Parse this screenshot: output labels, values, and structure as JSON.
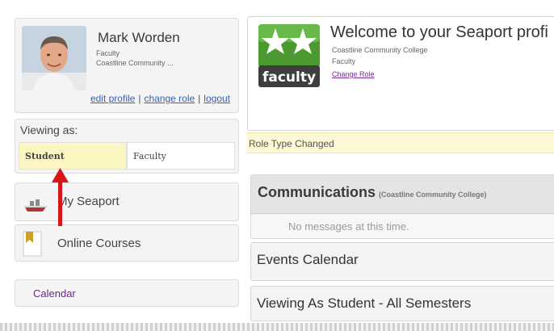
{
  "profile": {
    "name": "Mark Worden",
    "role": "Faculty",
    "organization": "Coastline Community ...",
    "links": {
      "edit_profile": "edit profile",
      "change_role": "change role",
      "logout": "logout",
      "separator": "|"
    }
  },
  "viewing_as": {
    "label": "Viewing as:",
    "options": [
      {
        "label": "Student",
        "selected": true
      },
      {
        "label": "Faculty",
        "selected": false
      }
    ]
  },
  "nav": {
    "my_seaport": "My Seaport",
    "online_courses": "Online Courses",
    "calendar": "Calendar"
  },
  "welcome": {
    "title": "Welcome to your Seaport profi",
    "organization": "Coastline Community College",
    "role": "Faculty",
    "change_role": "Change Role",
    "badge_text": "faculty"
  },
  "status": {
    "message": "Role Type Changed"
  },
  "communications": {
    "title": "Communications",
    "org": "(Coastline Community College)",
    "empty_message": "No messages at this time."
  },
  "sections": {
    "events_calendar": "Events Calendar",
    "viewing_semesters": "Viewing As Student - All Semesters"
  },
  "colors": {
    "link_blue": "#3b5fb0",
    "link_purple": "#7b2b9a",
    "highlight_yellow": "#fbf6c2",
    "badge_green": "#4a9a2f",
    "arrow_red": "#d8161a"
  },
  "icons": {
    "seaport": "ship-icon",
    "courses": "bookmark-icon",
    "badge": "faculty-stars-badge"
  }
}
